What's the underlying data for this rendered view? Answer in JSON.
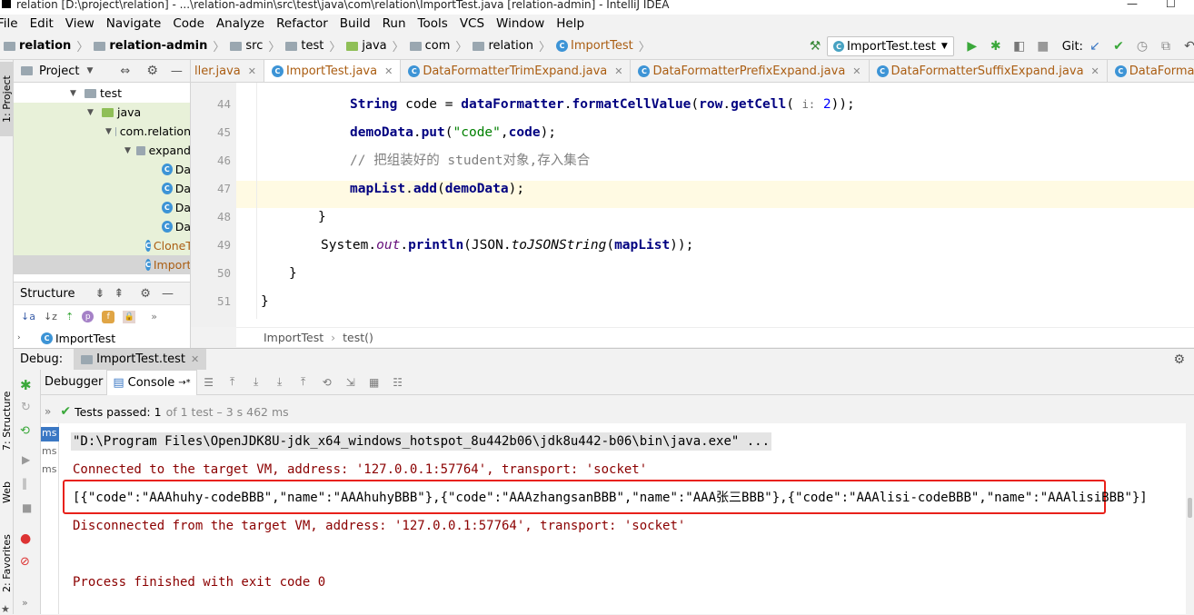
{
  "window": {
    "title": "relation [D:\\project\\relation] - ...\\relation-admin\\src\\test\\java\\com\\relation\\ImportTest.java [relation-admin] - IntelliJ IDEA"
  },
  "menu": [
    "File",
    "Edit",
    "View",
    "Navigate",
    "Code",
    "Analyze",
    "Refactor",
    "Build",
    "Run",
    "Tools",
    "VCS",
    "Window",
    "Help"
  ],
  "breadcrumbs": [
    "relation",
    "relation-admin",
    "src",
    "test",
    "java",
    "com",
    "relation",
    "ImportTest"
  ],
  "toolbar": {
    "run_config": "ImportTest.test",
    "git_label": "Git:"
  },
  "left_strip": {
    "project": "1: Project",
    "structure": "7: Structure",
    "web": "Web",
    "favorites": "2: Favorites"
  },
  "project_panel": {
    "title": "Project",
    "items": [
      {
        "label": "test"
      },
      {
        "label": "java"
      },
      {
        "label": "com.relation"
      },
      {
        "label": "expand"
      },
      {
        "label": "Da"
      },
      {
        "label": "Da"
      },
      {
        "label": "Da"
      },
      {
        "label": "Da"
      },
      {
        "label": "CloneTest"
      },
      {
        "label": "ImportTest"
      }
    ]
  },
  "structure_panel": {
    "title": "Structure",
    "item": "ImportTest"
  },
  "editor_tabs": [
    {
      "label": "ller.java"
    },
    {
      "label": "ImportTest.java"
    },
    {
      "label": "DataFormatterTrimExpand.java"
    },
    {
      "label": "DataFormatterPrefixExpand.java"
    },
    {
      "label": "DataFormatterSuffixExpand.java"
    },
    {
      "label": "DataFormatterFactory.java"
    }
  ],
  "code": {
    "line_numbers": [
      "44",
      "45",
      "46",
      "47",
      "48",
      "49",
      "50",
      "51"
    ],
    "l44": {
      "a": "String",
      "b": " code = ",
      "c": "dataFormatter",
      "d": ".",
      "e": "formatCellValue",
      "f": "(",
      "g": "row",
      "h": ".",
      "i": "getCell",
      "j": "( ",
      "k": "i:",
      "l": " 2",
      "m": "));"
    },
    "l45": {
      "a": "demoData",
      "b": ".",
      "c": "put",
      "d": "(",
      "e": "\"code\"",
      "f": ",",
      "g": "code",
      "h": ");"
    },
    "l46": "// 把组装好的 student对象,存入集合",
    "l47": {
      "a": "mapList",
      "b": ".",
      "c": "add",
      "d": "(",
      "e": "demoData",
      "f": ");"
    },
    "l48": "}",
    "l49": {
      "a": "System",
      "b": ".",
      "c": "out",
      "d": ".",
      "e": "println",
      "f": "(",
      "g": "JSON",
      "h": ".",
      "i": "toJSONString",
      "j": "(",
      "k": "mapList",
      "l": "));"
    },
    "l50": "}",
    "l51": "}"
  },
  "editor_breadcrumb": [
    "ImportTest",
    "test()"
  ],
  "debug": {
    "label": "Debug:",
    "config": "ImportTest.test",
    "tab_debugger": "Debugger",
    "tab_console": "Console"
  },
  "tests": {
    "passed_label": "Tests passed:",
    "passed_count": "1",
    "rest": "of 1 test – 3 s 462 ms"
  },
  "ms_labels": [
    "ms",
    "ms",
    "ms"
  ],
  "console": {
    "cmd": "\"D:\\Program Files\\OpenJDK8U-jdk_x64_windows_hotspot_8u442b06\\jdk8u442-b06\\bin\\java.exe\" ...",
    "connected": "Connected to the target VM, address: '127.0.0.1:57764', transport: 'socket'",
    "output": "[{\"code\":\"AAAhuhy-codeBBB\",\"name\":\"AAAhuhyBBB\"},{\"code\":\"AAAzhangsanBBB\",\"name\":\"AAA张三BBB\"},{\"code\":\"AAAlisi-codeBBB\",\"name\":\"AAAlisiBBB\"}]",
    "disconnected": "Disconnected from the target VM, address: '127.0.0.1:57764', transport: 'socket'",
    "finished": "Process finished with exit code 0"
  },
  "colors": {
    "highlight_box": "#e8211a",
    "console_red": "#8b0000",
    "string_green": "#008000",
    "keyword_navy": "#000080"
  }
}
